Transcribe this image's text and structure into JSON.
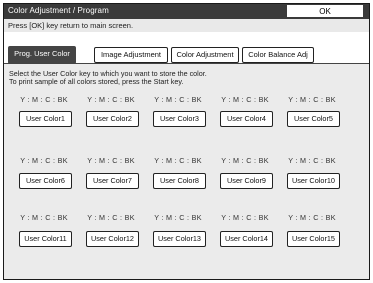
{
  "window": {
    "title": "Color Adjustment / Program",
    "ok_label": "OK"
  },
  "info": "Press [OK] key return to main screen.",
  "tabs": [
    {
      "label": "Prog. User Color",
      "active": true
    },
    {
      "label": "Image Adjustment",
      "active": false
    },
    {
      "label": "Color Adjustment",
      "active": false
    },
    {
      "label": "Color Balance Adj",
      "active": false
    }
  ],
  "instruction": {
    "line1": "Select the User Color key to which you want to store the color.",
    "line2": "To print sample of all colors stored, press the Start key."
  },
  "color_label": "Y : M : C : BK",
  "user_colors": [
    "User Color1",
    "User Color2",
    "User Color3",
    "User Color4",
    "User Color5",
    "User Color6",
    "User Color7",
    "User Color8",
    "User Color9",
    "User Color10",
    "User Color11",
    "User Color12",
    "User Color13",
    "User Color14",
    "User Color15"
  ]
}
